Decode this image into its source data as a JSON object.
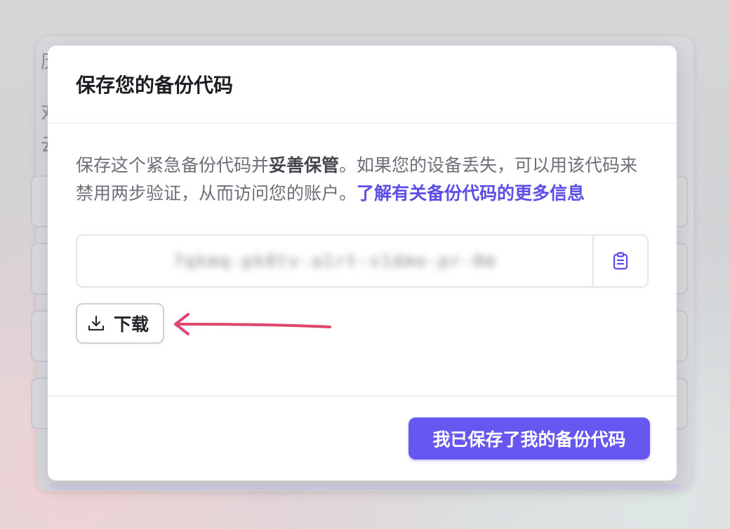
{
  "background": {
    "chars": [
      "历",
      "对",
      "云"
    ]
  },
  "modal": {
    "title": "保存您的备份代码",
    "description": {
      "part1": "保存这个紧急备份代码并",
      "emphasis": "妥善保管",
      "part2": "。如果您的设备丢失，可以用该代码来禁用两步验证，从而访问您的账户。",
      "link": "了解有关备份代码的更多信息"
    },
    "backup_code": "7qkmq-pk0tv-a1rt-s1dmo-pr-0m",
    "copy_icon": "clipboard-icon",
    "download_icon": "download-icon",
    "download_label": "下载",
    "confirm_label": "我已保存了我的备份代码"
  },
  "colors": {
    "accent": "#6657f1",
    "link": "#5b4ee6",
    "annotation_arrow": "#e0466d"
  }
}
